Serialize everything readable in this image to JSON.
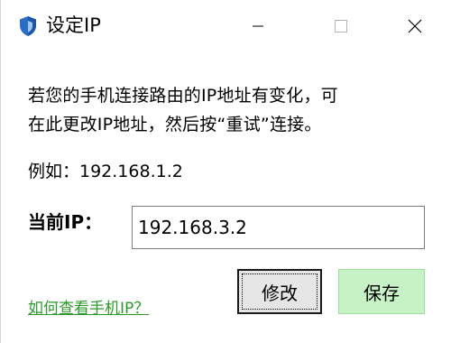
{
  "window": {
    "title": "设定IP",
    "icon": "shield-icon",
    "controls": [
      "minimize-icon",
      "maximize-icon",
      "close-icon"
    ]
  },
  "message": {
    "line1": "若您的手机连接路由的IP地址有变化，可",
    "line2": "在此更改IP地址，然后按“重试”连接。"
  },
  "example": {
    "text": "例如：192.168.1.2"
  },
  "ip_field": {
    "label": "当前IP：",
    "value": "192.168.3.2"
  },
  "help_link": {
    "text": "如何查看手机IP？"
  },
  "buttons": {
    "modify_label": "修改",
    "save_label": "保存"
  },
  "colors": {
    "accent_shield": "#2b6cc4",
    "link": "#2b9a2b",
    "save_button_bg": "#c6f2c6"
  }
}
